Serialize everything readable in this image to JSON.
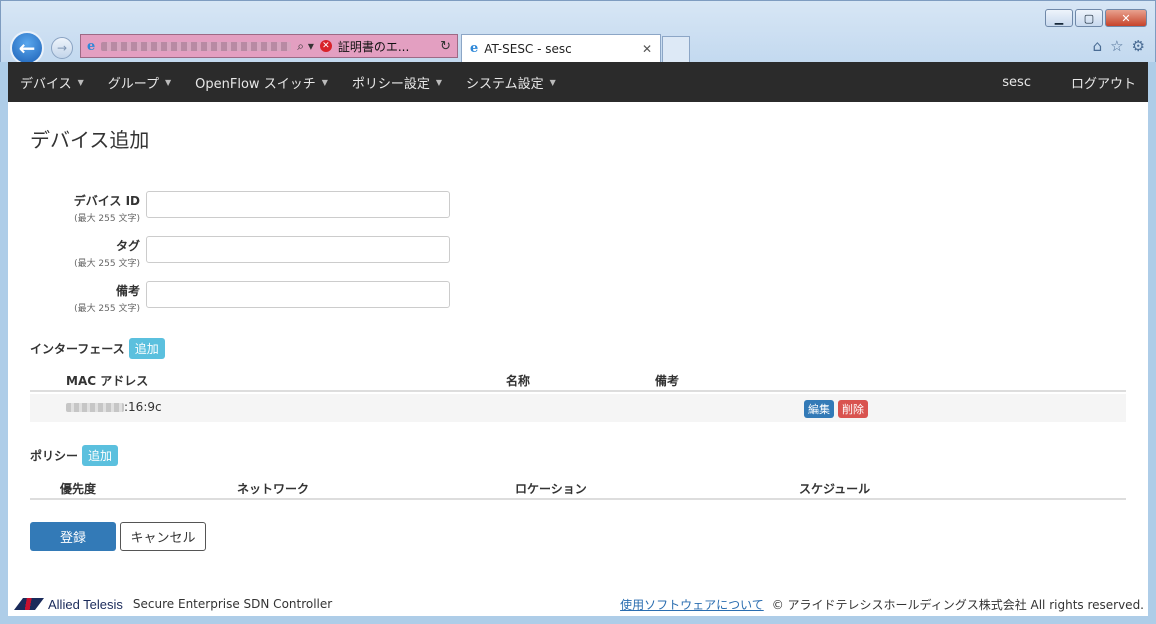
{
  "browser": {
    "cert_error_text": "証明書のエ...",
    "tab_title": "AT-SESC - sesc"
  },
  "navbar": {
    "items": [
      {
        "label": "デバイス"
      },
      {
        "label": "グループ"
      },
      {
        "label": "OpenFlow スイッチ"
      },
      {
        "label": "ポリシー設定"
      },
      {
        "label": "システム設定"
      }
    ],
    "user": "sesc",
    "logout": "ログアウト"
  },
  "page": {
    "title": "デバイス追加"
  },
  "form": {
    "device_id": {
      "label": "デバイス ID",
      "hint": "(最大 255 文字)",
      "value": ""
    },
    "tag": {
      "label": "タグ",
      "hint": "(最大 255 文字)",
      "value": ""
    },
    "note": {
      "label": "備考",
      "hint": "(最大 255 文字)",
      "value": ""
    }
  },
  "interfaces": {
    "heading": "インターフェース",
    "add_label": "追加",
    "columns": [
      "MAC アドレス",
      "名称",
      "備考"
    ],
    "rows": [
      {
        "mac_suffix": ":16:9c",
        "name": "",
        "note": "",
        "edit_label": "編集",
        "delete_label": "削除"
      }
    ]
  },
  "policies": {
    "heading": "ポリシー",
    "add_label": "追加",
    "columns": [
      "優先度",
      "ネットワーク",
      "ロケーション",
      "スケジュール"
    ]
  },
  "actions": {
    "submit": "登録",
    "cancel": "キャンセル"
  },
  "footer": {
    "brand": "Allied Telesis",
    "product": "Secure Enterprise SDN Controller",
    "software_link": "使用ソフトウェアについて",
    "copyright": "© アライドテレシスホールディングス株式会社 All rights reserved."
  },
  "colors": {
    "navbar_bg": "#2b2b2b",
    "primary": "#337ab7",
    "info": "#5bc0de",
    "danger": "#d9534f"
  }
}
